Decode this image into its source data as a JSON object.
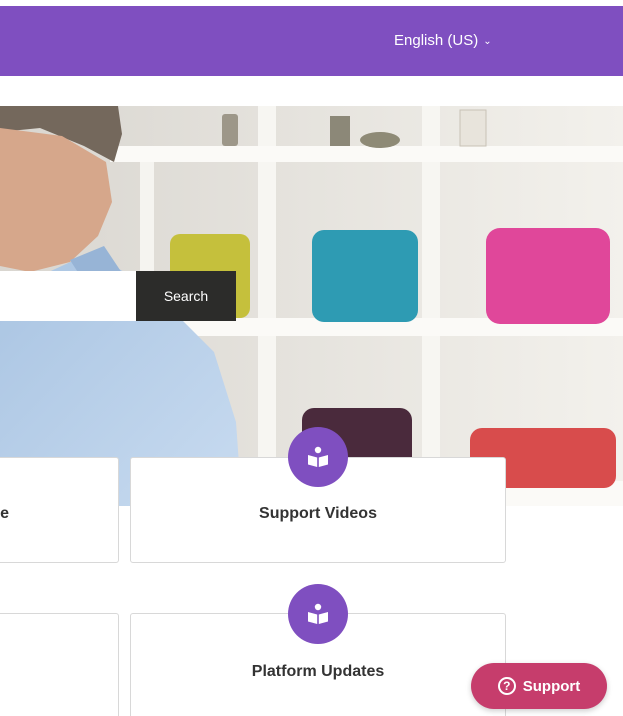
{
  "header": {
    "language": {
      "label": "English (US)",
      "icon": "chevron-down-icon"
    }
  },
  "search": {
    "placeholder": "",
    "button_label": "Search"
  },
  "cards": {
    "row1_left": {
      "label_fragment": "e"
    },
    "row1": {
      "label": "Support Videos",
      "icon": "book-icon"
    },
    "row2": {
      "label": "Platform Updates",
      "icon": "book-icon"
    }
  },
  "support_widget": {
    "label": "Support",
    "icon": "help-circle-icon",
    "icon_glyph": "?"
  },
  "colors": {
    "brand_purple": "#7f4fc0",
    "search_button": "#2c2c2a",
    "support_pink": "#c63d6c",
    "card_border": "#d8d8d8"
  }
}
